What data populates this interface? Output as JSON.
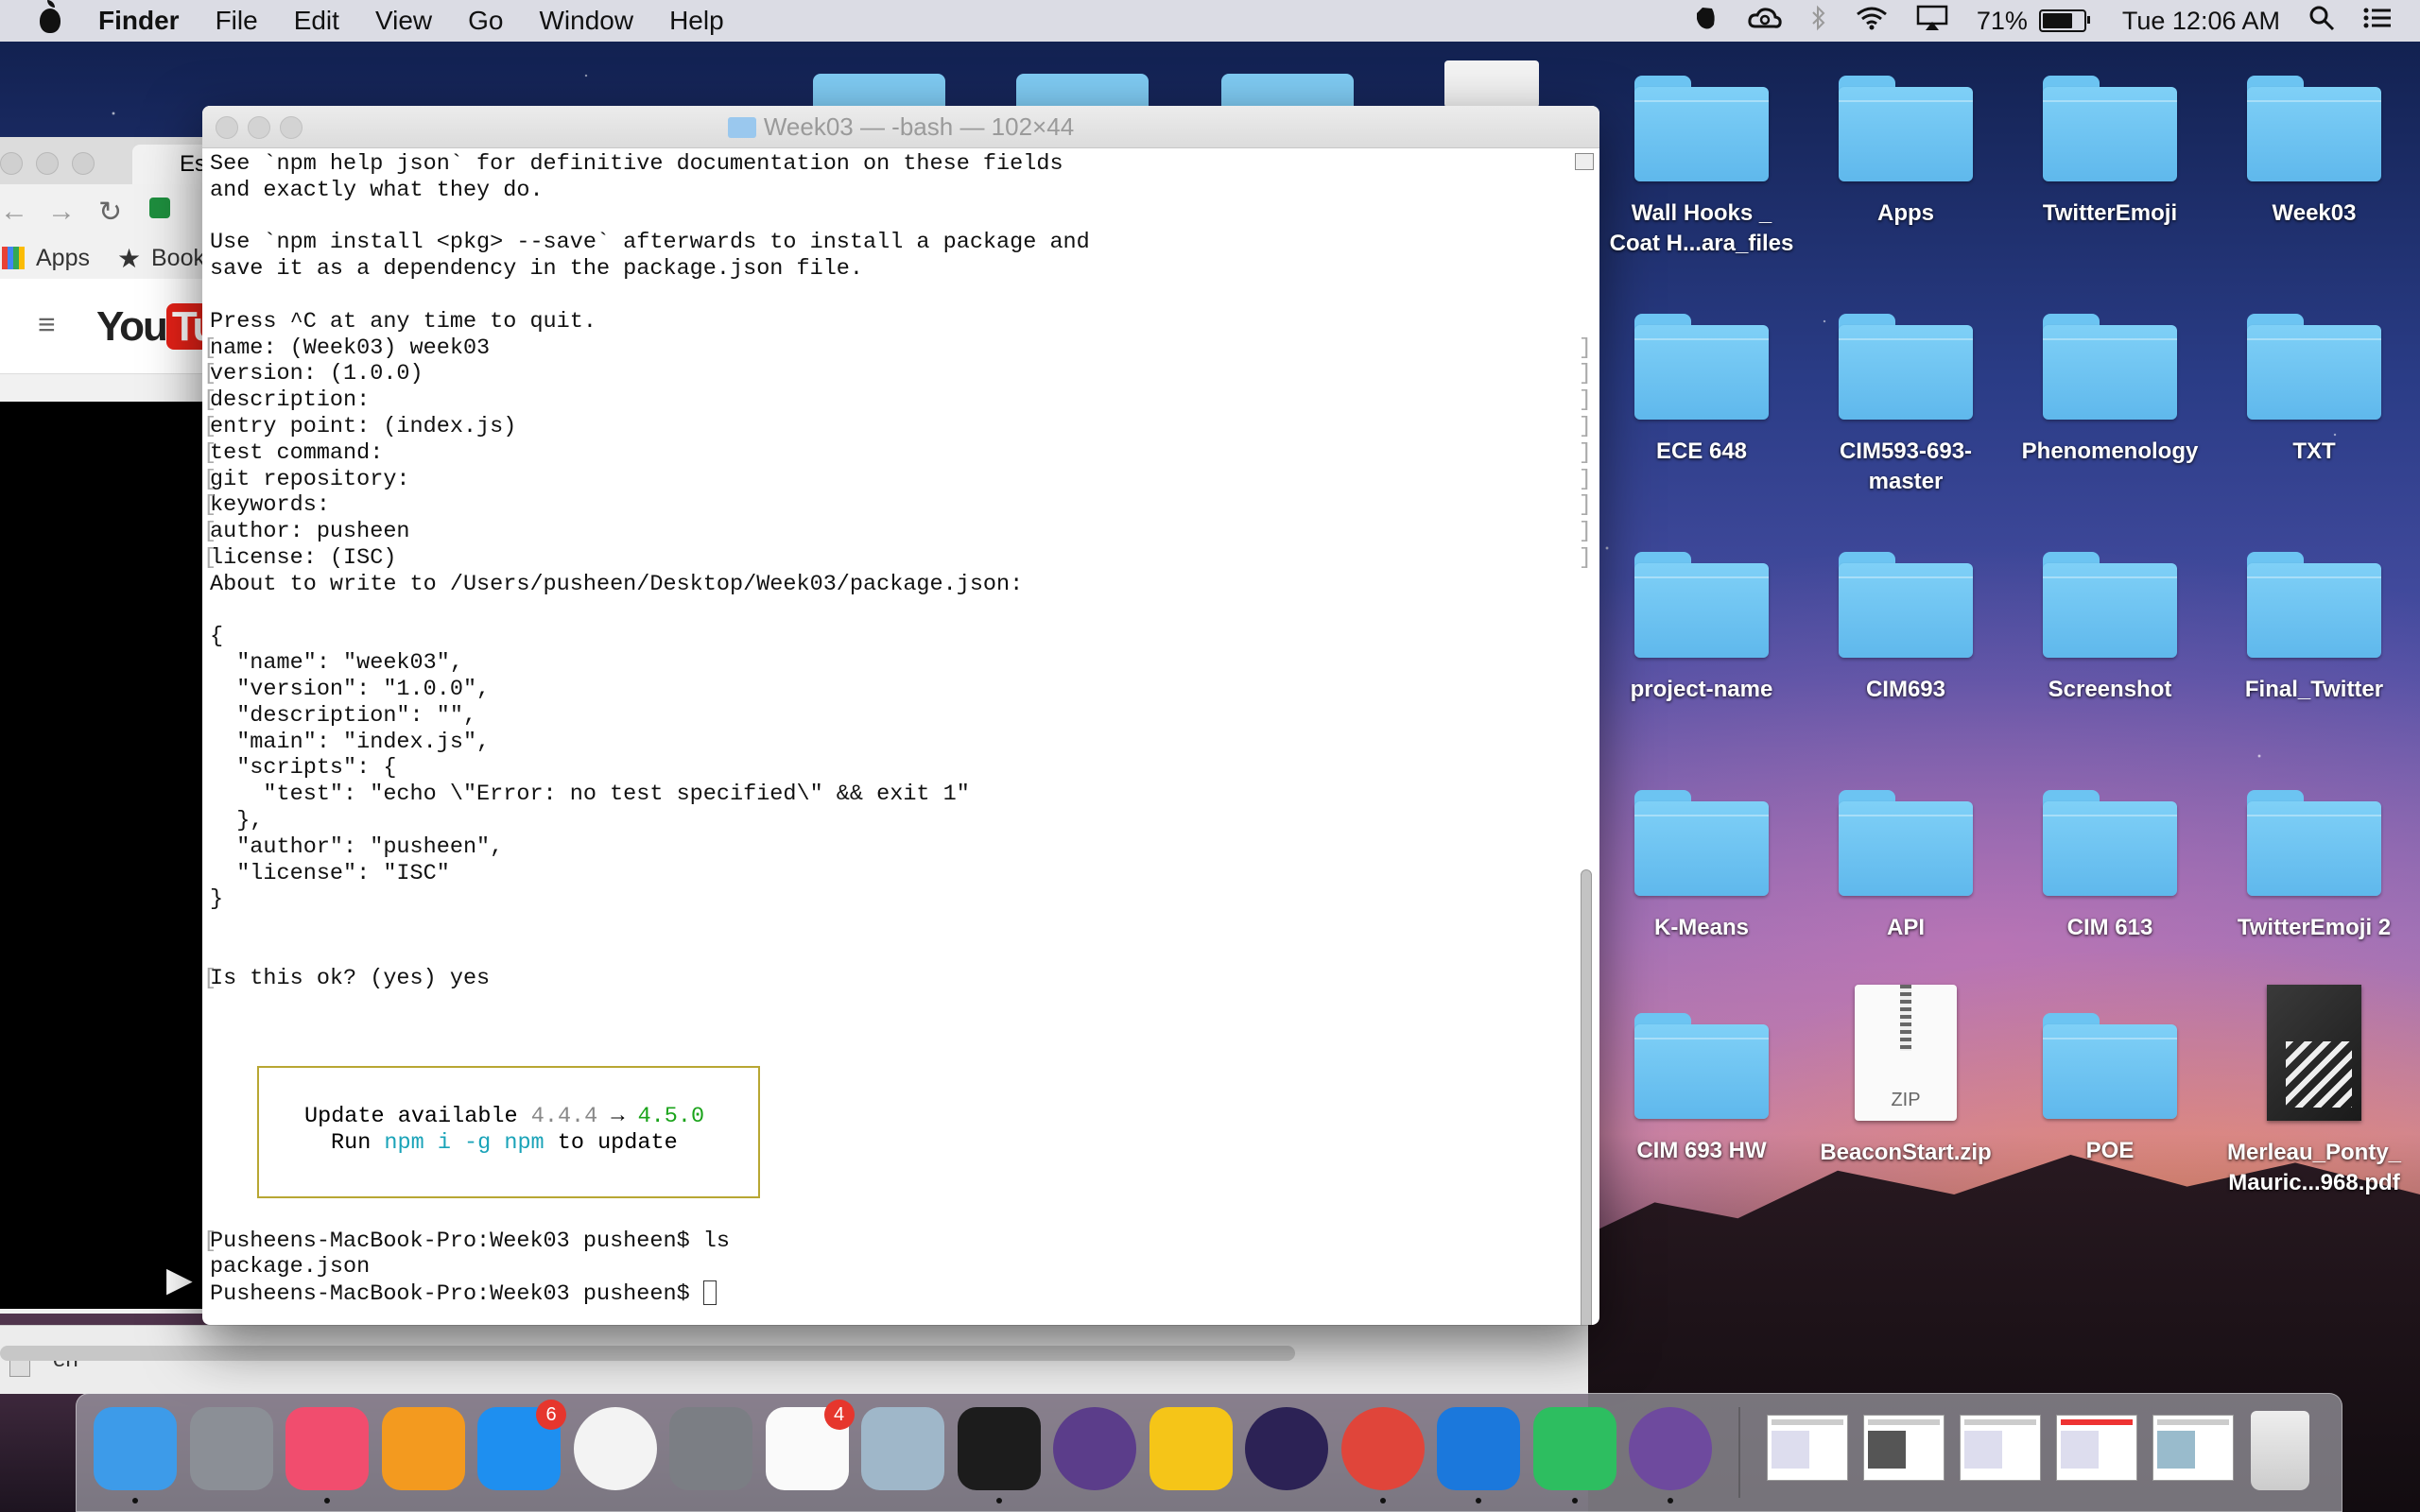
{
  "menubar": {
    "app_name": "Finder",
    "menus": [
      "File",
      "Edit",
      "View",
      "Go",
      "Window",
      "Help"
    ],
    "battery_percent": "71%",
    "clock": "Tue 12:06 AM"
  },
  "chrome_window": {
    "tab_label": "Es",
    "bookmarks": [
      "Apps",
      "Book"
    ],
    "bottom_text": "en"
  },
  "terminal": {
    "title": "Week03 — -bash — 102×44",
    "lines": [
      {
        "t": "See `npm help json` for definitive documentation on these fields",
        "m": false
      },
      {
        "t": "and exactly what they do.",
        "m": false
      },
      {
        "t": "",
        "m": false
      },
      {
        "t": "Use `npm install <pkg> --save` afterwards to install a package and",
        "m": false
      },
      {
        "t": "save it as a dependency in the package.json file.",
        "m": false
      },
      {
        "t": "",
        "m": false
      },
      {
        "t": "Press ^C at any time to quit.",
        "m": false
      },
      {
        "t": "name: (Week03) week03",
        "m": true
      },
      {
        "t": "version: (1.0.0)",
        "m": true
      },
      {
        "t": "description:",
        "m": true
      },
      {
        "t": "entry point: (index.js)",
        "m": true
      },
      {
        "t": "test command:",
        "m": true
      },
      {
        "t": "git repository:",
        "m": true
      },
      {
        "t": "keywords:",
        "m": true
      },
      {
        "t": "author: pusheen",
        "m": true
      },
      {
        "t": "license: (ISC)",
        "m": true
      },
      {
        "t": "About to write to /Users/pusheen/Desktop/Week03/package.json:",
        "m": false
      },
      {
        "t": "",
        "m": false
      },
      {
        "t": "{",
        "m": false
      },
      {
        "t": "  \"name\": \"week03\",",
        "m": false
      },
      {
        "t": "  \"version\": \"1.0.0\",",
        "m": false
      },
      {
        "t": "  \"description\": \"\",",
        "m": false
      },
      {
        "t": "  \"main\": \"index.js\",",
        "m": false
      },
      {
        "t": "  \"scripts\": {",
        "m": false
      },
      {
        "t": "    \"test\": \"echo \\\"Error: no test specified\\\" && exit 1\"",
        "m": false
      },
      {
        "t": "  },",
        "m": false
      },
      {
        "t": "  \"author\": \"pusheen\",",
        "m": false
      },
      {
        "t": "  \"license\": \"ISC\"",
        "m": false
      },
      {
        "t": "}",
        "m": false
      },
      {
        "t": "",
        "m": false
      },
      {
        "t": "",
        "m": false
      },
      {
        "t": "Is this ok? (yes) yes",
        "m": true
      }
    ],
    "update_box": {
      "line1_prefix": "Update available ",
      "old_version": "4.4.4",
      "arrow": " → ",
      "new_version": "4.5.0",
      "line2_prefix": "Run ",
      "command": "npm i -g npm",
      "line2_suffix": " to update"
    },
    "tail_lines": [
      {
        "t": "Pusheens-MacBook-Pro:Week03 pusheen$ ls",
        "m": true
      },
      {
        "t": "package.json",
        "m": false
      }
    ],
    "prompt": "Pusheens-MacBook-Pro:Week03 pusheen$ "
  },
  "desktop": {
    "icons": [
      {
        "label": "Wall Hooks _\nCoat H...ara_files",
        "kind": "folder"
      },
      {
        "label": "Apps",
        "kind": "folder"
      },
      {
        "label": "TwitterEmoji",
        "kind": "folder"
      },
      {
        "label": "Week03",
        "kind": "folder"
      },
      {
        "label": "ECE 648",
        "kind": "folder"
      },
      {
        "label": "CIM593-693-\nmaster",
        "kind": "folder"
      },
      {
        "label": "Phenomenology",
        "kind": "folder"
      },
      {
        "label": "TXT",
        "kind": "folder"
      },
      {
        "label": "project-name",
        "kind": "folder"
      },
      {
        "label": "CIM693",
        "kind": "folder"
      },
      {
        "label": "Screenshot",
        "kind": "folder"
      },
      {
        "label": "Final_Twitter",
        "kind": "folder"
      },
      {
        "label": "K-Means",
        "kind": "folder"
      },
      {
        "label": "API",
        "kind": "folder"
      },
      {
        "label": "CIM 613",
        "kind": "folder"
      },
      {
        "label": "TwitterEmoji 2",
        "kind": "folder"
      },
      {
        "label": "CIM 693 HW",
        "kind": "folder"
      },
      {
        "label": "BeaconStart.zip",
        "kind": "zip",
        "badge": "ZIP"
      },
      {
        "label": "POE",
        "kind": "folder"
      },
      {
        "label": "Merleau_Ponty_\nMauric...968.pdf",
        "kind": "pdf"
      }
    ]
  },
  "dock": {
    "items": [
      {
        "name": "finder",
        "color": "#3d9be9",
        "running": true
      },
      {
        "name": "launchpad",
        "color": "#8b8f96",
        "running": false
      },
      {
        "name": "itunes",
        "color": "#f14d6e",
        "running": true
      },
      {
        "name": "ibooks",
        "color": "#f39a1f",
        "running": false
      },
      {
        "name": "app-store",
        "color": "#1e8ff0",
        "running": false,
        "badge": "6"
      },
      {
        "name": "photos",
        "color": "#f3f3f3",
        "running": false
      },
      {
        "name": "system-preferences",
        "color": "#7b7e84",
        "running": false
      },
      {
        "name": "reminders",
        "color": "#fafafa",
        "running": false,
        "badge": "4"
      },
      {
        "name": "preview",
        "color": "#9fb7c9",
        "running": false
      },
      {
        "name": "terminal",
        "color": "#1c1c1c",
        "running": true
      },
      {
        "name": "github-desktop",
        "color": "#5b3d8a",
        "running": false
      },
      {
        "name": "webstorm",
        "color": "#f5c518",
        "running": false
      },
      {
        "name": "eclipse",
        "color": "#2c2255",
        "running": false
      },
      {
        "name": "chrome",
        "color": "#e0453a",
        "running": true
      },
      {
        "name": "xcode",
        "color": "#1b78dc",
        "running": true
      },
      {
        "name": "evernote",
        "color": "#2dbe60",
        "running": true
      },
      {
        "name": "github",
        "color": "#6e4a9e",
        "running": true
      }
    ]
  }
}
